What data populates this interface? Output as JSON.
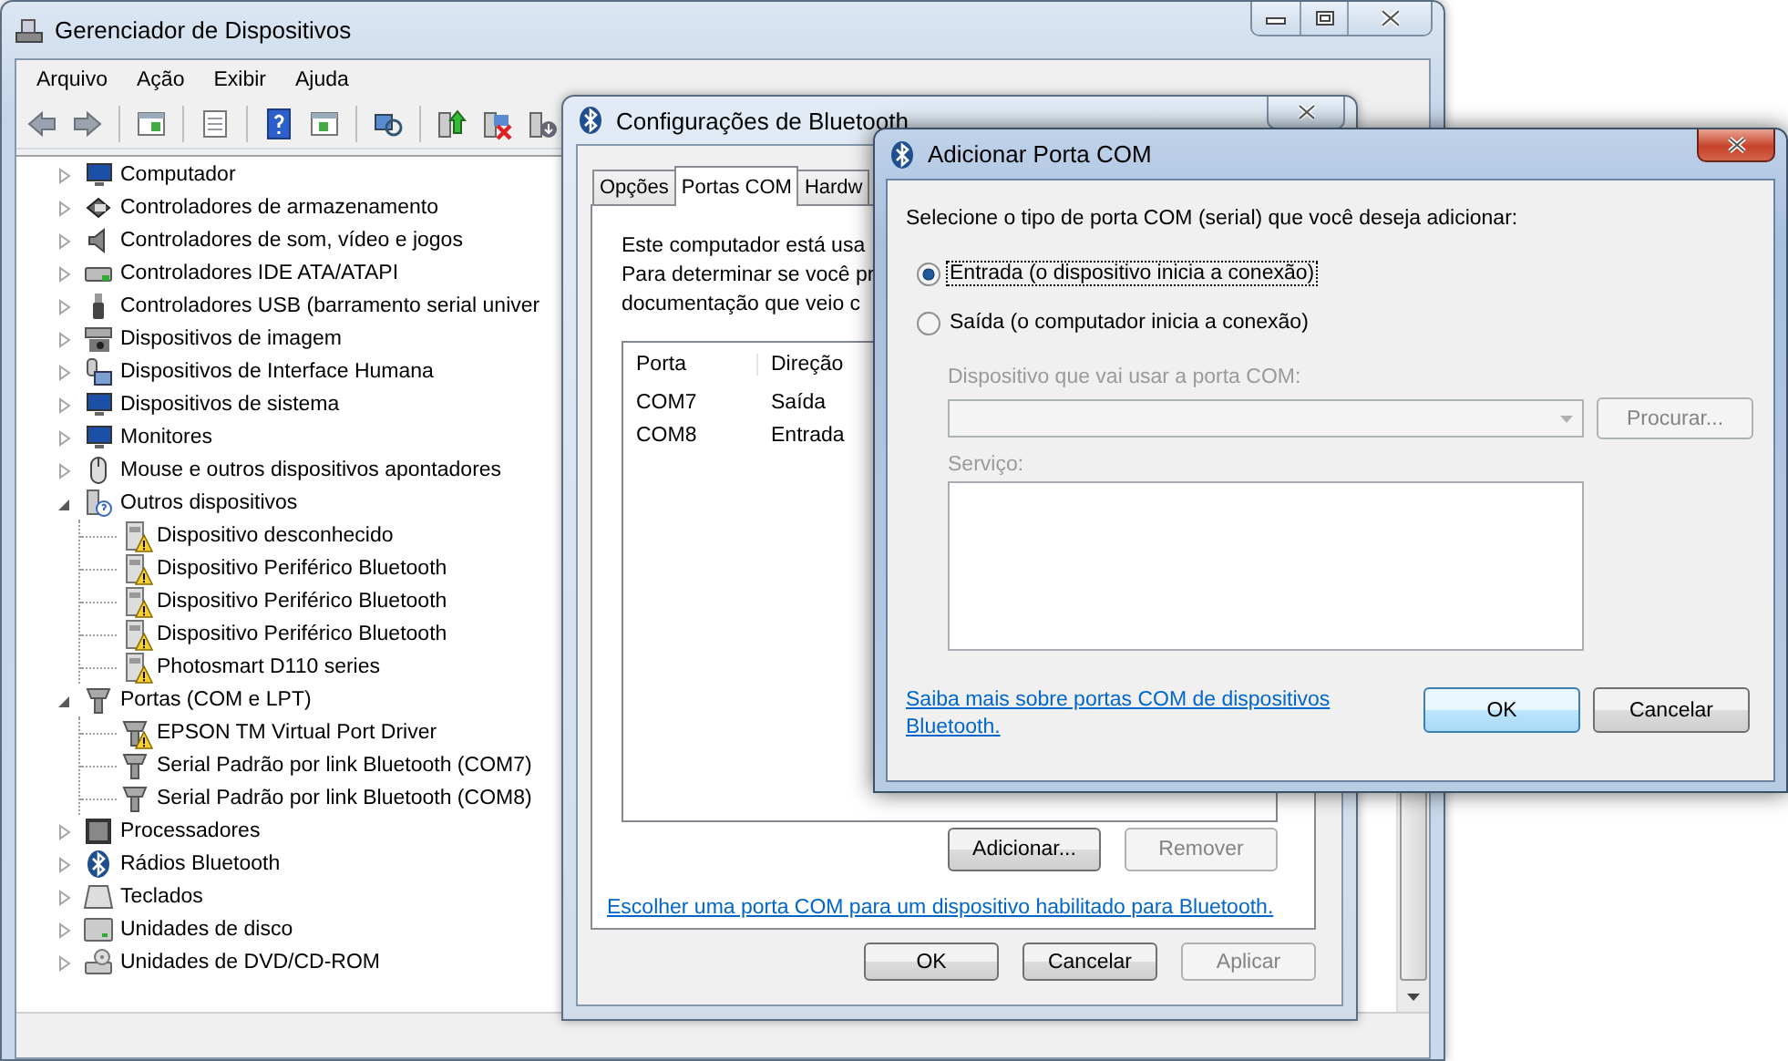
{
  "device_manager": {
    "title": "Gerenciador de Dispositivos",
    "menu": [
      "Arquivo",
      "Ação",
      "Exibir",
      "Ajuda"
    ],
    "tree": [
      {
        "label": "Computador",
        "expanded": false
      },
      {
        "label": "Controladores de armazenamento",
        "expanded": false
      },
      {
        "label": "Controladores de som, vídeo e jogos",
        "expanded": false
      },
      {
        "label": "Controladores IDE ATA/ATAPI",
        "expanded": false
      },
      {
        "label": "Controladores USB (barramento serial univer",
        "expanded": false
      },
      {
        "label": "Dispositivos de imagem",
        "expanded": false
      },
      {
        "label": "Dispositivos de Interface Humana",
        "expanded": false
      },
      {
        "label": "Dispositivos de sistema",
        "expanded": false
      },
      {
        "label": "Monitores",
        "expanded": false
      },
      {
        "label": "Mouse e outros dispositivos apontadores",
        "expanded": false
      },
      {
        "label": "Outros dispositivos",
        "expanded": true,
        "children": [
          {
            "label": "Dispositivo desconhecido",
            "warning": true
          },
          {
            "label": "Dispositivo Periférico Bluetooth",
            "warning": true
          },
          {
            "label": "Dispositivo Periférico Bluetooth",
            "warning": true
          },
          {
            "label": "Dispositivo Periférico Bluetooth",
            "warning": true
          },
          {
            "label": "Photosmart D110 series",
            "warning": true
          }
        ]
      },
      {
        "label": "Portas (COM e LPT)",
        "expanded": true,
        "children": [
          {
            "label": "EPSON TM Virtual Port Driver",
            "warning": true
          },
          {
            "label": "Serial Padrão por link Bluetooth (COM7)",
            "warning": false
          },
          {
            "label": "Serial Padrão por link Bluetooth (COM8)",
            "warning": false
          }
        ]
      },
      {
        "label": "Processadores",
        "expanded": false
      },
      {
        "label": "Rádios Bluetooth",
        "expanded": false
      },
      {
        "label": "Teclados",
        "expanded": false
      },
      {
        "label": "Unidades de disco",
        "expanded": false
      },
      {
        "label": "Unidades de DVD/CD-ROM",
        "expanded": false
      }
    ]
  },
  "bluetooth_settings": {
    "title": "Configurações de Bluetooth",
    "tabs": [
      {
        "label": "Opções",
        "selected": false
      },
      {
        "label": "Portas COM",
        "selected": true
      },
      {
        "label": "Hardw",
        "selected": false
      }
    ],
    "description_lines": [
      "Este computador está usa",
      "Para determinar se você pr",
      "documentação que veio c"
    ],
    "ports_table": {
      "columns": [
        "Porta",
        "Direção"
      ],
      "rows": [
        [
          "COM7",
          "Saída"
        ],
        [
          "COM8",
          "Entrada"
        ]
      ]
    },
    "list_buttons": [
      {
        "label": "Adicionar...",
        "disabled": false
      },
      {
        "label": "Remover",
        "disabled": true
      }
    ],
    "link": "Escolher uma porta COM para um dispositivo habilitado para Bluetooth.",
    "buttons": [
      {
        "label": "OK",
        "disabled": false
      },
      {
        "label": "Cancelar",
        "disabled": false
      },
      {
        "label": "Aplicar",
        "disabled": true
      }
    ]
  },
  "add_com_port": {
    "title": "Adicionar Porta COM",
    "prompt": "Selecione o tipo de porta COM (serial) que você deseja adicionar:",
    "options": [
      {
        "label": "Entrada (o dispositivo inicia a conexão)",
        "selected": true,
        "focused": true
      },
      {
        "label": "Saída (o computador inicia a conexão)",
        "selected": false,
        "focused": false
      }
    ],
    "device_label": "Dispositivo que vai usar a porta COM:",
    "device_disabled": true,
    "browse_button": {
      "label": "Procurar...",
      "disabled": true
    },
    "service_label": "Serviço:",
    "link": "Saiba mais sobre portas COM de dispositivos Bluetooth.",
    "buttons": [
      {
        "label": "OK",
        "default": true
      },
      {
        "label": "Cancelar",
        "default": false
      }
    ]
  }
}
